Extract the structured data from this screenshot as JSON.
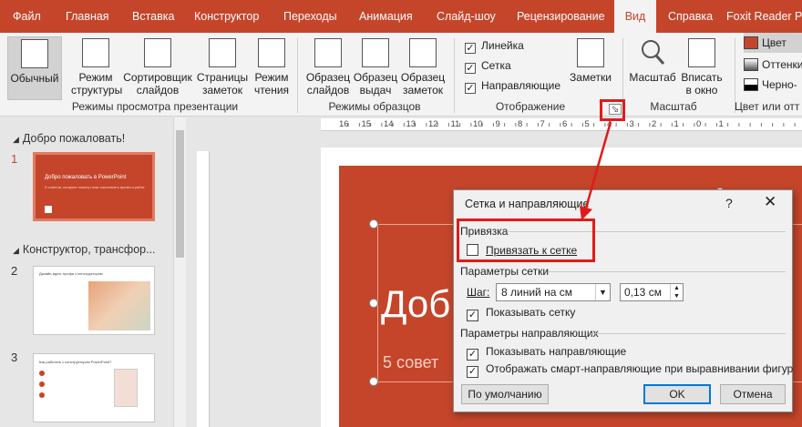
{
  "tabs": [
    "Файл",
    "Главная",
    "Вставка",
    "Конструктор",
    "Переходы",
    "Анимация",
    "Слайд-шоу",
    "Рецензирование",
    "Вид",
    "Справка",
    "Foxit Reader P"
  ],
  "active_tab": "Вид",
  "ribbon": {
    "view_modes": {
      "normal": [
        "Обычный"
      ],
      "outline": [
        "Режим",
        "структуры"
      ],
      "sorter": [
        "Сортировщик",
        "слайдов"
      ],
      "notes_page": [
        "Страницы",
        "заметок"
      ],
      "reading": [
        "Режим",
        "чтения"
      ],
      "group_label": "Режимы просмотра презентации"
    },
    "masters": {
      "slide_master": [
        "Образец",
        "слайдов"
      ],
      "handout_master": [
        "Образец",
        "выдач"
      ],
      "notes_master": [
        "Образец",
        "заметок"
      ],
      "group_label": "Режимы образцов"
    },
    "show": {
      "ruler": "Линейка",
      "gridlines": "Сетка",
      "guides": "Направляющие",
      "notes": "Заметки",
      "group_label": "Отображение"
    },
    "zoom": {
      "zoom": "Масштаб",
      "fit": [
        "Вписать",
        "в окно"
      ],
      "group_label": "Масштаб"
    },
    "color": {
      "color": "Цвет",
      "grayscale": "Оттенки",
      "bw": "Черно-",
      "group_label": "Цвет или отт"
    }
  },
  "thumbnails": {
    "section1": "Добро пожаловать!",
    "section2": "Конструктор, трансфор...",
    "slide_numbers": [
      "1",
      "2",
      "3"
    ],
    "slide1_title": "Добро пожаловать в PowerPoint",
    "slide1_sub": "5 советов, которые помогут вам сэкономить время и работу",
    "slide2_title": "Дизайн-идеи: профи с конструктором",
    "slide3_title": "Как работать с конструктором PowerPoint?"
  },
  "ruler_numbers": [
    "16",
    "15",
    "14",
    "13",
    "12",
    "11",
    "10",
    "9",
    "8",
    "7",
    "6",
    "5",
    "4",
    "3",
    "2",
    "1",
    "0",
    "1"
  ],
  "slide": {
    "title": "Добро",
    "subtitle": "5 совет"
  },
  "dialog": {
    "title": "Сетка и направляющие",
    "help": "?",
    "close": "✕",
    "snap_header": "Привязка",
    "snap_to_grid": "Привязать к сетке",
    "snap_checked": false,
    "grid_header": "Параметры сетки",
    "spacing_label": "Шаг:",
    "spacing_value": "8 линий на см",
    "spacing_number": "0,13 см",
    "show_grid": "Показывать сетку",
    "show_grid_checked": true,
    "guides_header": "Параметры направляющих",
    "show_guides": "Показывать направляющие",
    "show_guides_checked": true,
    "smart_guides": "Отображать смарт-направляющие при выравнивании фигур",
    "smart_guides_checked": true,
    "default_button": "По умолчанию",
    "ok_button": "OK",
    "cancel_button": "Отмена"
  },
  "colors": {
    "accent": "#c5452a",
    "highlight": "#e11b1b"
  }
}
